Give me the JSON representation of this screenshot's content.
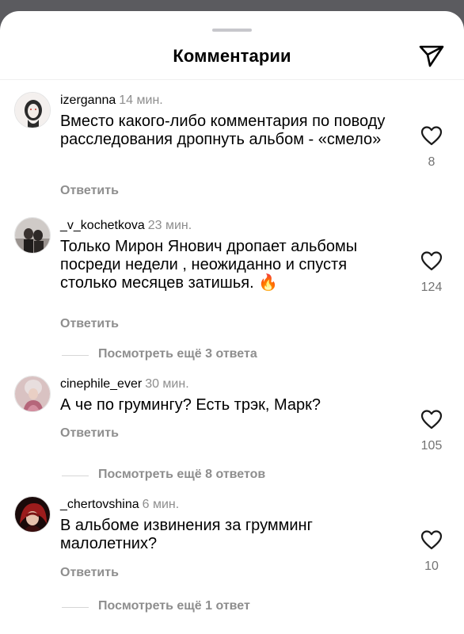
{
  "header": {
    "title": "Комментарии"
  },
  "comments": [
    {
      "username": "izerganna",
      "time": "14 мин.",
      "text": "Вместо какого-либо комментария по поводу расследования дропнуть альбом - «смело»",
      "reply_label": "Ответить",
      "likes": "8",
      "more_replies": ""
    },
    {
      "username": "_v_kochetkova",
      "time": "23 мин.",
      "text": "Только Мирон Янович дропает альбомы посреди недели , неожиданно и спустя столько месяцев затишья. 🔥",
      "reply_label": "Ответить",
      "likes": "124",
      "more_replies": "Посмотреть ещё 3 ответа"
    },
    {
      "username": "cinephile_ever",
      "time": "30 мин.",
      "text": "А че по грумингу? Есть трэк,  Марк?",
      "reply_label": "Ответить",
      "likes": "105",
      "more_replies": "Посмотреть ещё 8 ответов"
    },
    {
      "username": "_chertovshina",
      "time": "6 мин.",
      "text": "В альбоме извинения за грумминг малолетних?",
      "reply_label": "Ответить",
      "likes": "10",
      "more_replies": "Посмотреть ещё 1 ответ"
    }
  ],
  "icons": {
    "share": "paper-plane-icon",
    "like": "heart-icon"
  }
}
